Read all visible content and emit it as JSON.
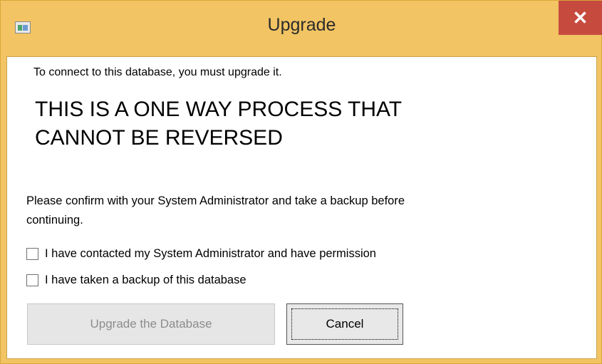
{
  "window": {
    "title": "Upgrade",
    "close_glyph": "✕",
    "icon": "app-window-icon"
  },
  "message": {
    "intro": "To connect to this database, you must upgrade it.",
    "warning_line1": "THIS IS A ONE WAY PROCESS THAT",
    "warning_line2": "CANNOT BE REVERSED",
    "confirm_line1": "Please confirm with your System Administrator and take a backup before",
    "confirm_line2": "continuing."
  },
  "checkboxes": [
    {
      "label": "I have contacted my System Administrator and have permission",
      "checked": false
    },
    {
      "label": "I have taken a backup of this database",
      "checked": false
    }
  ],
  "buttons": {
    "upgrade_label": "Upgrade the Database",
    "upgrade_enabled": false,
    "cancel_label": "Cancel"
  },
  "colors": {
    "titlebar": "#f2c463",
    "close": "#c74a3f"
  }
}
